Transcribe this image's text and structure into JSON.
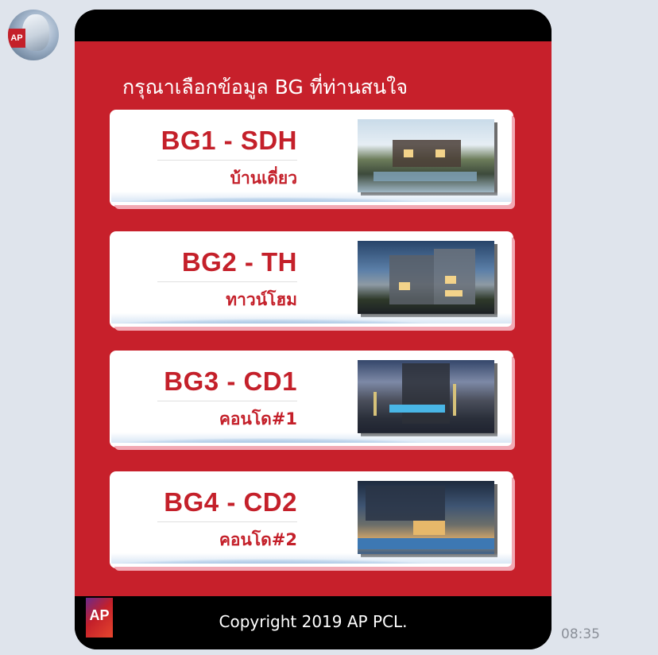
{
  "message": {
    "headline": "กรุณาเลือกข้อมูล BG ที่ท่านสนใจ",
    "cards": [
      {
        "title": "BG1 - SDH",
        "subtitle": "บ้านเดี่ยว"
      },
      {
        "title": "BG2 - TH",
        "subtitle": "ทาวน์โฮม"
      },
      {
        "title": "BG3 - CD1",
        "subtitle": "คอนโด#1"
      },
      {
        "title": "BG4 - CD2",
        "subtitle": "คอนโด#2"
      }
    ],
    "footer": {
      "logo_text": "AP",
      "copyright": "Copyright 2019 AP PCL."
    },
    "timestamp": "08:35"
  },
  "avatar": {
    "logo_text": "AP"
  },
  "colors": {
    "brand_red": "#c7202b",
    "title_red": "#c4202a",
    "chat_bg": "#dfe4ec"
  },
  "icons": [
    "bot-avatar-icon",
    "ap-logo-icon"
  ]
}
